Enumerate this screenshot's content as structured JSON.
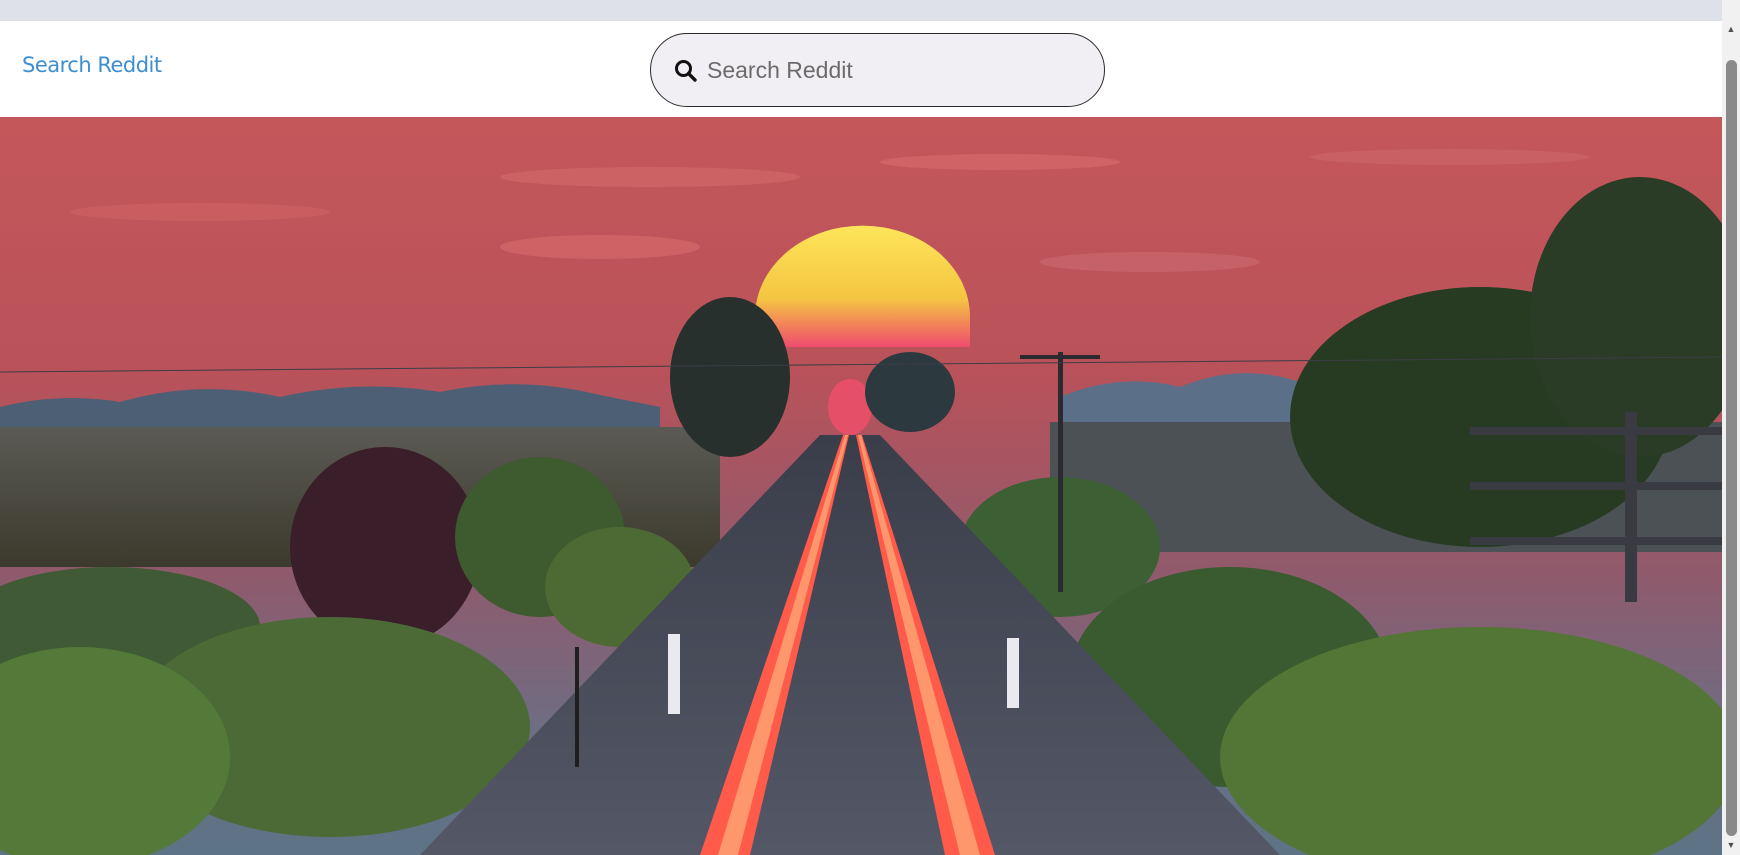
{
  "header": {
    "brand_label": "Search Reddit",
    "search": {
      "placeholder": "Search Reddit",
      "value": "",
      "icon": "search-icon"
    }
  },
  "hero": {
    "image": "railroad tracks leading to a setting sun over fields"
  },
  "scrollbar": {
    "up_arrow": "▲",
    "down_arrow": "▼"
  }
}
